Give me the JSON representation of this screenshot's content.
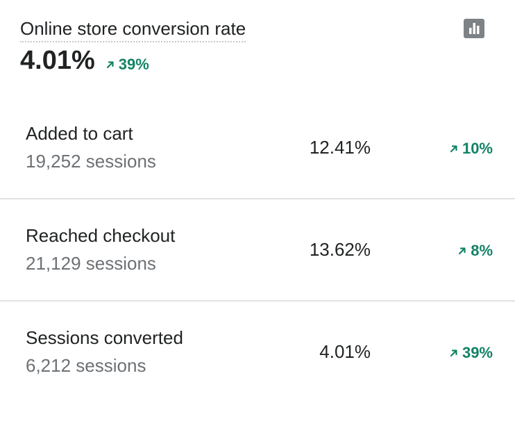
{
  "header": {
    "title": "Online store conversion rate",
    "value": "4.01%",
    "change": "39%",
    "chart_button_icon": "bar-chart-icon"
  },
  "rows": [
    {
      "label": "Added to cart",
      "sessions": "19,252 sessions",
      "rate": "12.41%",
      "change": "10%"
    },
    {
      "label": "Reached checkout",
      "sessions": "21,129 sessions",
      "rate": "13.62%",
      "change": "8%"
    },
    {
      "label": "Sessions converted",
      "sessions": "6,212 sessions",
      "rate": "4.01%",
      "change": "39%"
    }
  ],
  "colors": {
    "positive": "#128365",
    "text": "#202223",
    "subdued": "#6d7175",
    "divider": "#dfe1e3",
    "icon_bg": "#7d8287"
  }
}
